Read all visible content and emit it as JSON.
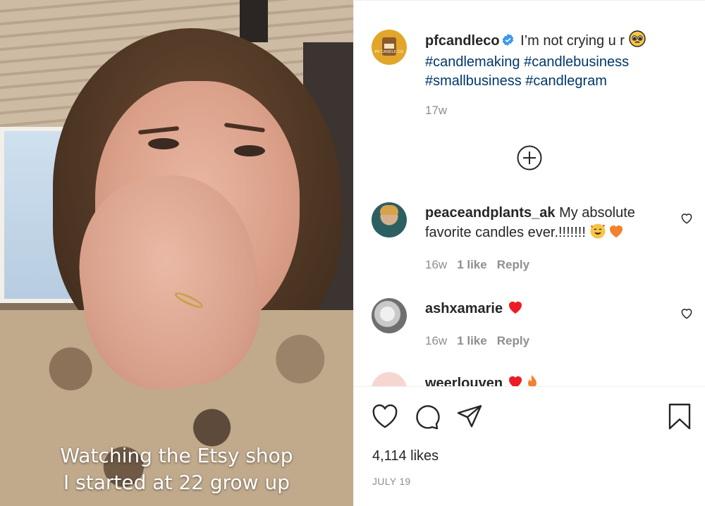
{
  "media": {
    "caption_line1": "Watching the Etsy shop",
    "caption_line2": "I started at 22 grow up"
  },
  "post": {
    "username": "pfcandleco",
    "avatar_text": "PF CANDLE CO",
    "caption_text": "I’m not crying u r",
    "hashtags": [
      "#candlemaking",
      "#candlebusiness",
      "#smallbusiness",
      "#candlegram"
    ],
    "age": "17w",
    "verified": true
  },
  "comments": [
    {
      "username": "peaceandplants_ak",
      "text": "My absolute favorite candles ever.!!!!!!!",
      "emojis": [
        "smiling-face-with-hearts",
        "orange-heart"
      ],
      "age": "16w",
      "likes": "1 like",
      "reply": "Reply"
    },
    {
      "username": "ashxamarie",
      "text": "",
      "emojis": [
        "red-heart"
      ],
      "age": "16w",
      "likes": "1 like",
      "reply": "Reply"
    },
    {
      "username": "weerlouven",
      "text": "",
      "emojis": [
        "red-heart",
        "fire"
      ]
    }
  ],
  "actions": {
    "likes": "4,114 likes",
    "date": "JULY 19"
  },
  "colors": {
    "hashtag": "#00376b",
    "verified": "#3897f0",
    "text": "#262626",
    "muted": "#8e8e8e",
    "heart_red": "#ed1c24",
    "heart_orange": "#f4812d"
  }
}
